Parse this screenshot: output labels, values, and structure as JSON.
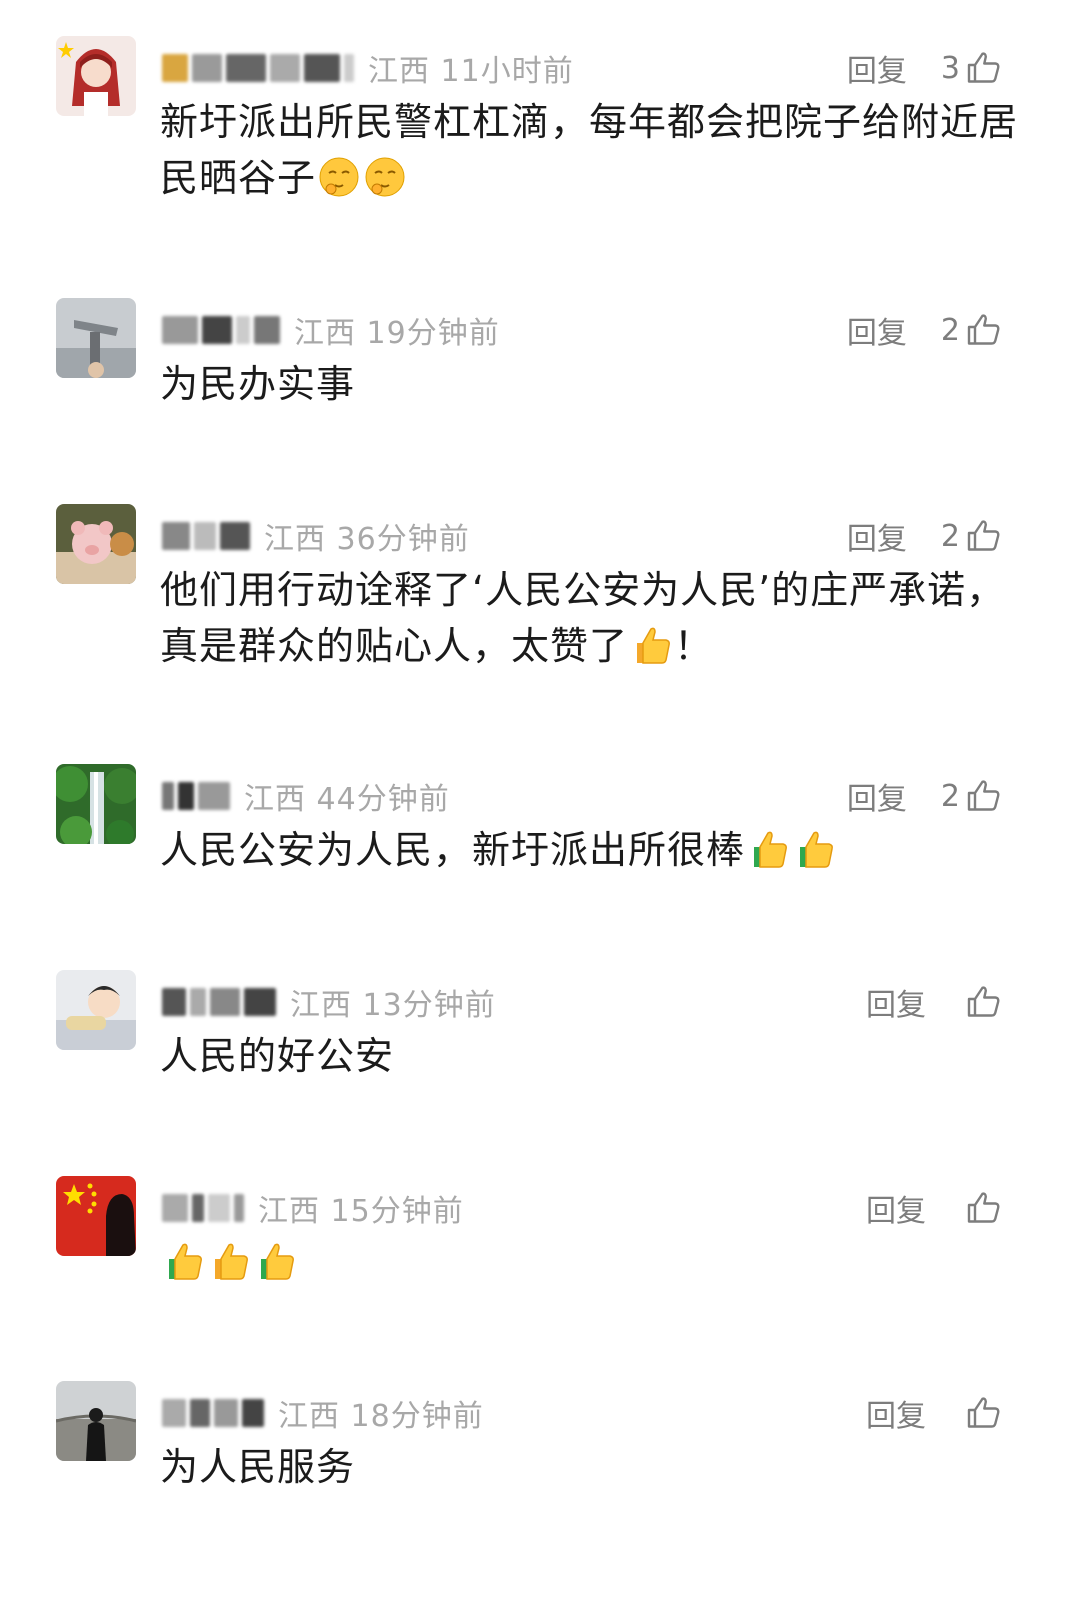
{
  "reply_label": "回复",
  "comments": [
    {
      "region_time": "江西 11小时前",
      "likes": "3",
      "text": "新圩派出所民警杠杠滴，每年都会把院子给附近居民晒谷子",
      "text_emojis": [
        "shy-face-emoji",
        "shy-face-emoji"
      ]
    },
    {
      "region_time": "江西 19分钟前",
      "likes": "2",
      "text": "为民办实事",
      "text_emojis": []
    },
    {
      "region_time": "江西 36分钟前",
      "likes": "2",
      "text": "他们用行动诠释了‘人民公安为人民’的庄严承诺，真是群众的贴心人，太赞了",
      "text_emojis": [
        "thumbs-up-emoji"
      ],
      "text_tail": "！"
    },
    {
      "region_time": "江西 44分钟前",
      "likes": "2",
      "text": "人民公安为人民，新圩派出所很棒",
      "text_emojis": [
        "thumbs-up-emoji",
        "thumbs-up-emoji"
      ]
    },
    {
      "region_time": "江西 13分钟前",
      "likes": "",
      "text": "人民的好公安",
      "text_emojis": []
    },
    {
      "region_time": "江西 15分钟前",
      "likes": "",
      "text": "",
      "text_emojis": [
        "thumbs-up-emoji",
        "thumbs-up-emoji",
        "thumbs-up-emoji"
      ]
    },
    {
      "region_time": "江西 18分钟前",
      "likes": "",
      "text": "为人民服务",
      "text_emojis": []
    }
  ],
  "icons": {
    "like": "thumbs-up-outline-icon"
  },
  "colors": {
    "meta_gray": "#a8a8a8",
    "action_gray": "#7d7d7d",
    "text": "#1b1b1b"
  }
}
